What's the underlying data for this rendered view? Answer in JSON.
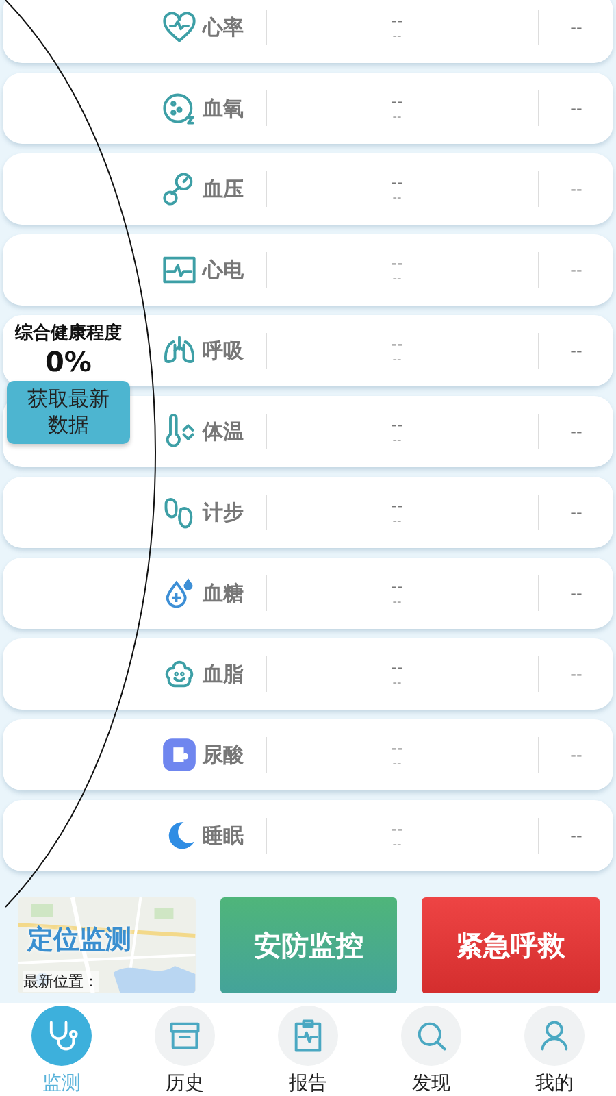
{
  "metrics": [
    {
      "kind": "heart",
      "name": "心率",
      "value_top": "--",
      "value_bottom": "--",
      "value_right": "--"
    },
    {
      "kind": "oxygen",
      "name": "血氧",
      "value_top": "--",
      "value_bottom": "--",
      "value_right": "--"
    },
    {
      "kind": "pressure",
      "name": "血压",
      "value_top": "--",
      "value_bottom": "--",
      "value_right": "--"
    },
    {
      "kind": "ecg",
      "name": "心电",
      "value_top": "--",
      "value_bottom": "--",
      "value_right": "--"
    },
    {
      "kind": "lungs",
      "name": "呼吸",
      "value_top": "--",
      "value_bottom": "--",
      "value_right": "--"
    },
    {
      "kind": "thermometer",
      "name": "体温",
      "value_top": "--",
      "value_bottom": "--",
      "value_right": "--"
    },
    {
      "kind": "feet",
      "name": "计步",
      "value_top": "--",
      "value_bottom": "--",
      "value_right": "--"
    },
    {
      "kind": "glucose",
      "name": "血糖",
      "value_top": "--",
      "value_bottom": "--",
      "value_right": "--"
    },
    {
      "kind": "lipid",
      "name": "血脂",
      "value_top": "--",
      "value_bottom": "--",
      "value_right": "--"
    },
    {
      "kind": "uric",
      "name": "尿酸",
      "value_top": "--",
      "value_bottom": "--",
      "value_right": "--"
    },
    {
      "kind": "sleep",
      "name": "睡眠",
      "value_top": "--",
      "value_bottom": "--",
      "value_right": "--"
    }
  ],
  "health": {
    "title": "综合健康程度",
    "score": "0%",
    "refresh_button": "获取最新数据"
  },
  "actions": [
    {
      "kind": "map",
      "label": "定位监测",
      "caption": "最新位置："
    },
    {
      "kind": "green",
      "label": "安防监控"
    },
    {
      "kind": "red",
      "label": "紧急呼救"
    }
  ],
  "tabs": [
    {
      "kind": "stethoscope",
      "label": "监测",
      "selected": true
    },
    {
      "kind": "archive",
      "label": "历史",
      "selected": false
    },
    {
      "kind": "clipboard",
      "label": "报告",
      "selected": false
    },
    {
      "kind": "search",
      "label": "发现",
      "selected": false
    },
    {
      "kind": "person",
      "label": "我的",
      "selected": false
    }
  ]
}
